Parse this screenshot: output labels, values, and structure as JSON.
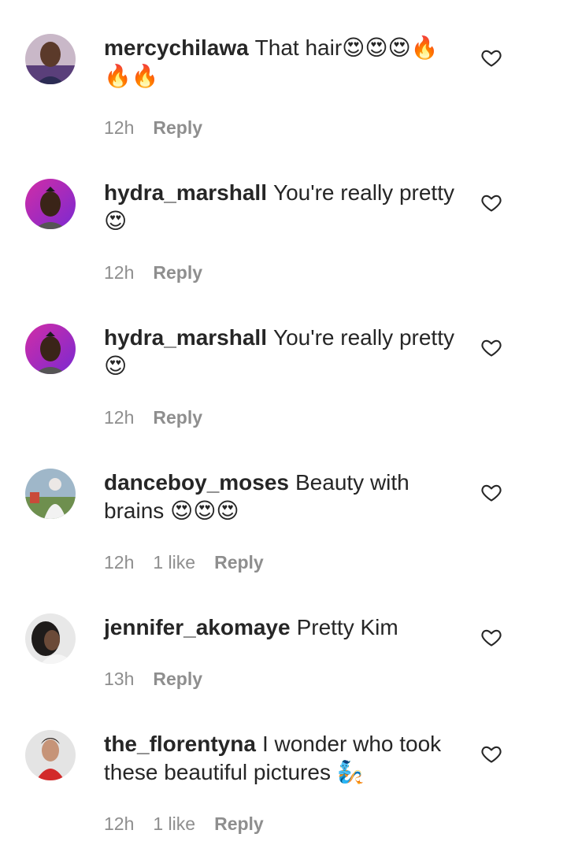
{
  "comments": [
    {
      "username": "mercychilawa",
      "text": "That hair😍😍😍🔥🔥🔥",
      "time": "12h",
      "likes": "",
      "reply": "Reply",
      "avatar": "avatar-photo-woman"
    },
    {
      "username": "hydra_marshall",
      "text": "You're really pretty 😍",
      "time": "12h",
      "likes": "",
      "reply": "Reply",
      "avatar": "avatar-cartoon-man"
    },
    {
      "username": "hydra_marshall",
      "text": "You're really pretty 😍",
      "time": "12h",
      "likes": "",
      "reply": "Reply",
      "avatar": "avatar-cartoon-man"
    },
    {
      "username": "danceboy_moses",
      "text": "Beauty with brains 😍😍😍",
      "time": "12h",
      "likes": "1 like",
      "reply": "Reply",
      "avatar": "avatar-photo-man"
    },
    {
      "username": "jennifer_akomaye",
      "text": "Pretty Kim",
      "time": "13h",
      "likes": "",
      "reply": "Reply",
      "avatar": "avatar-photo-woman"
    },
    {
      "username": "the_florentyna",
      "text": "I wonder who took these beautiful pictures 🧞",
      "time": "12h",
      "likes": "1 like",
      "reply": "Reply",
      "avatar": "avatar-photo-woman"
    }
  ]
}
